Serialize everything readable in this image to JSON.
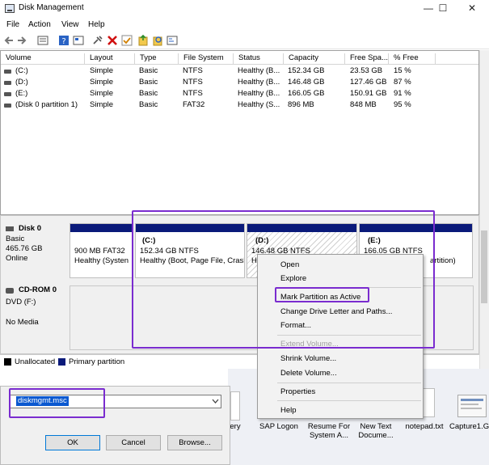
{
  "window": {
    "title": "Disk Management",
    "controls": [
      "—",
      "☐",
      "✕"
    ]
  },
  "menu": [
    "File",
    "Action",
    "View",
    "Help"
  ],
  "toolbar_icons": [
    "back-arrow-icon",
    "forward-arrow-icon",
    "list-view-icon",
    "help-icon",
    "properties-icon",
    "connect-icon",
    "delete-icon",
    "check-icon",
    "export-icon",
    "search-icon",
    "rescan-icon"
  ],
  "volumes": {
    "headers": [
      "Volume",
      "Layout",
      "Type",
      "File System",
      "Status",
      "Capacity",
      "Free Spa...",
      "% Free"
    ],
    "rows": [
      [
        "(C:)",
        "Simple",
        "Basic",
        "NTFS",
        "Healthy (B...",
        "152.34 GB",
        "23.53 GB",
        "15 %"
      ],
      [
        "(D:)",
        "Simple",
        "Basic",
        "NTFS",
        "Healthy (B...",
        "146.48 GB",
        "127.46 GB",
        "87 %"
      ],
      [
        "(E:)",
        "Simple",
        "Basic",
        "NTFS",
        "Healthy (B...",
        "166.05 GB",
        "150.91 GB",
        "91 %"
      ],
      [
        "(Disk 0 partition 1)",
        "Simple",
        "Basic",
        "FAT32",
        "Healthy (S...",
        "896 MB",
        "848 MB",
        "95 %"
      ]
    ]
  },
  "disk0": {
    "name": "Disk 0",
    "type": "Basic",
    "size": "465.76 GB",
    "status": "Online",
    "partitions": [
      {
        "title": "",
        "size": "900 MB FAT32",
        "status": "Healthy (Systen"
      },
      {
        "title": "(C:)",
        "size": "152.34 GB NTFS",
        "status": "Healthy (Boot, Page File, Crash"
      },
      {
        "title": "(D:)",
        "size": "146.48 GB NTFS",
        "status": "He"
      },
      {
        "title": "(E:)",
        "size": "166.05 GB NTFS",
        "status": "artition)"
      }
    ]
  },
  "cdrom": {
    "name": "CD-ROM 0",
    "type": "DVD (F:)",
    "status": "No Media"
  },
  "legend": {
    "unallocated": "Unallocated",
    "primary": "Primary partition",
    "unallocated_color": "#000000",
    "primary_color": "#0a1a7a"
  },
  "context_menu": {
    "open": "Open",
    "explore": "Explore",
    "mark_active": "Mark Partition as Active",
    "change_letter": "Change Drive Letter and Paths...",
    "format": "Format...",
    "extend": "Extend Volume...",
    "shrink": "Shrink Volume...",
    "delete": "Delete Volume...",
    "properties": "Properties",
    "help": "Help"
  },
  "desktop": {
    "items": [
      {
        "label": "ery",
        "label2": ""
      },
      {
        "label": "SAP Logon",
        "label2": ""
      },
      {
        "label": "Resume For",
        "label2": "System A..."
      },
      {
        "label": "New Text",
        "label2": "Docume..."
      },
      {
        "label": "notepad.txt",
        "label2": ""
      },
      {
        "label": "Capture1.G",
        "label2": ""
      }
    ]
  },
  "run": {
    "input_value": "diskmgmt.msc",
    "ok": "OK",
    "cancel": "Cancel",
    "browse": "Browse..."
  },
  "accent": "#7a2ccf",
  "selection_color": "#0a58d0"
}
